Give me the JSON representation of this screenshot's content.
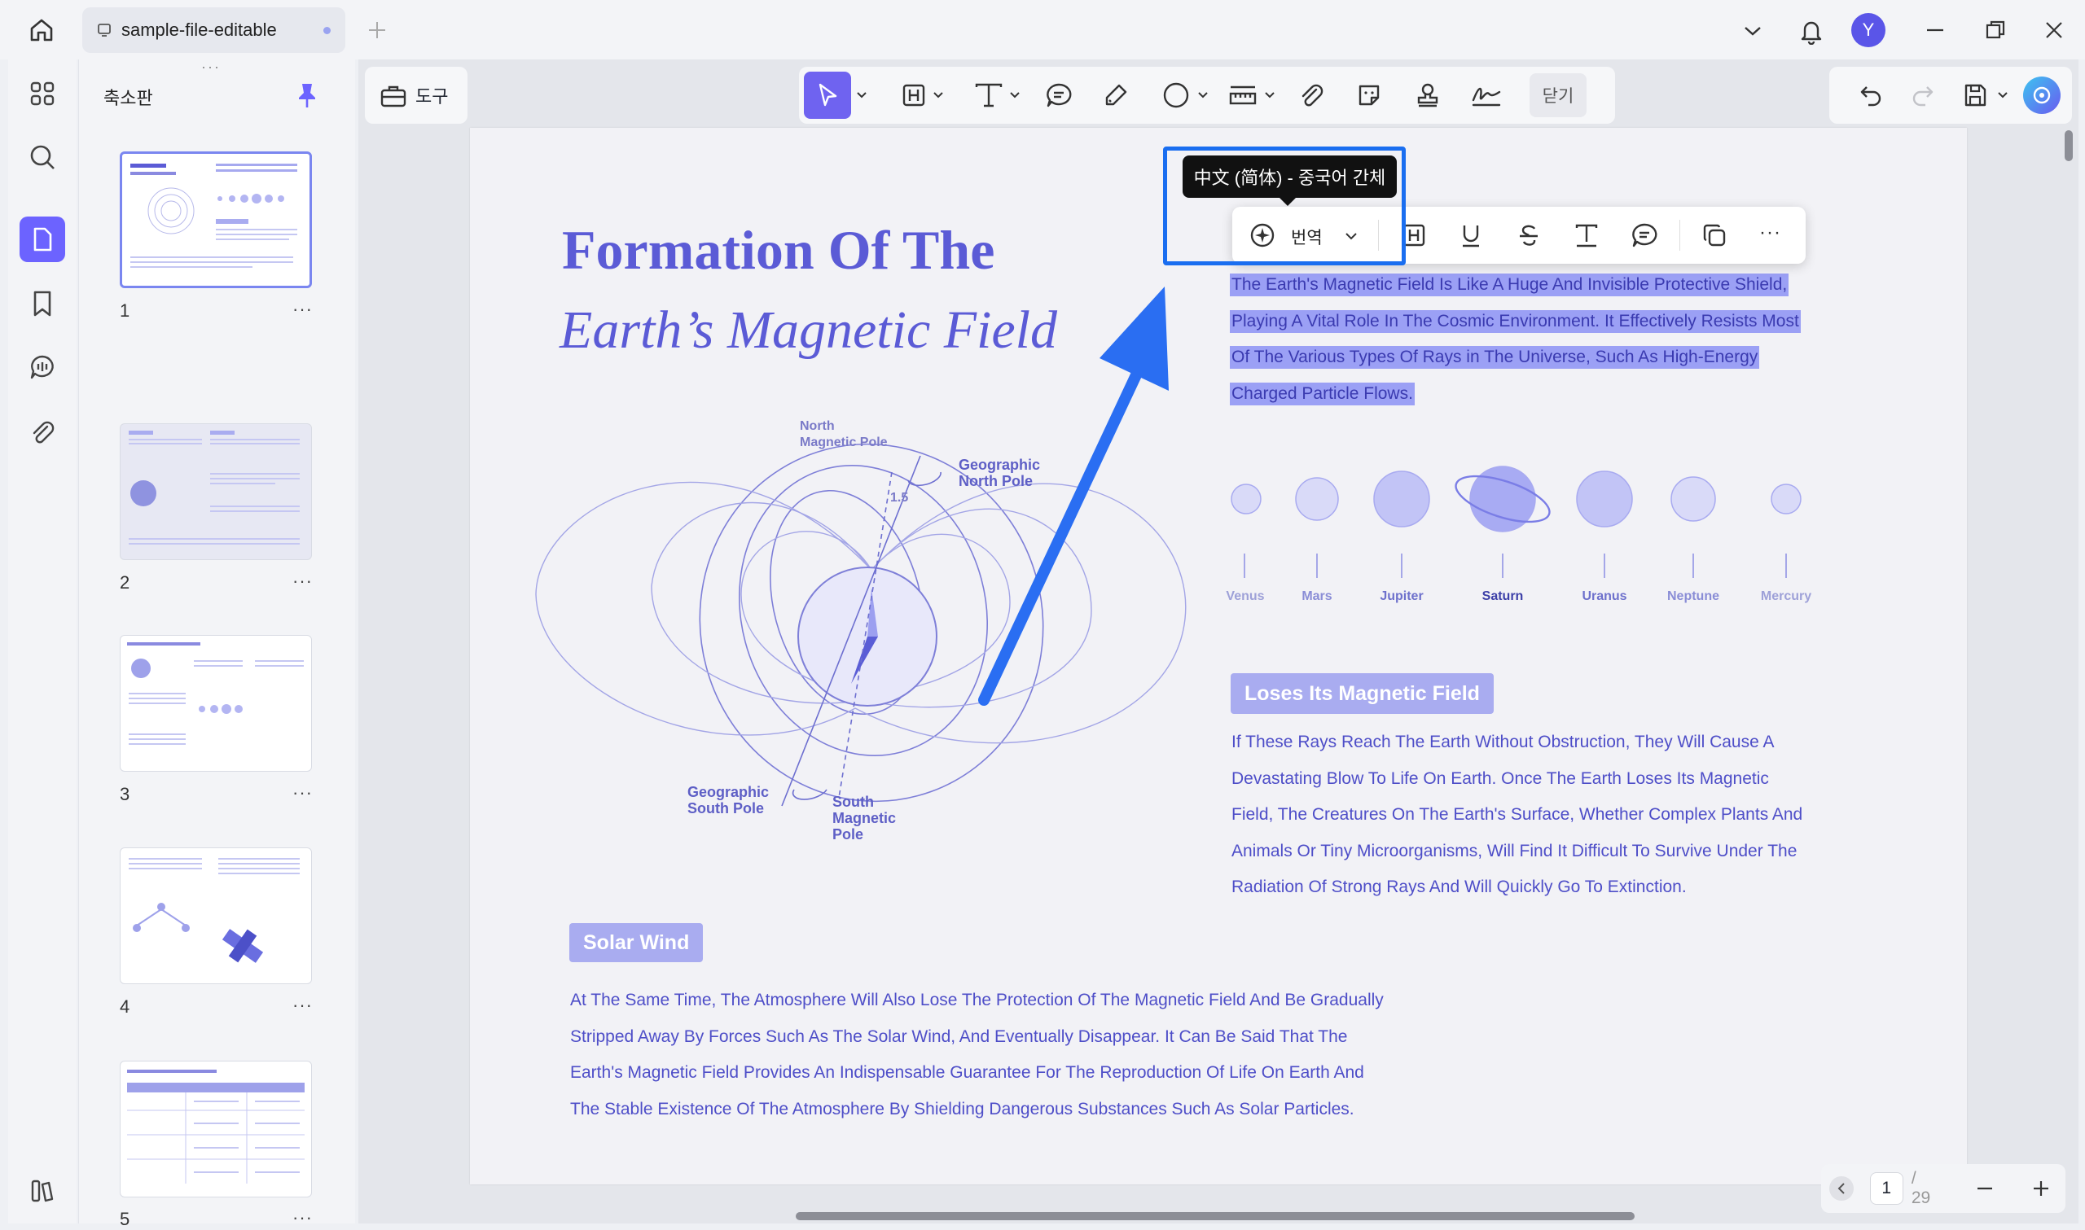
{
  "window": {
    "tab_title": "sample-file-editable",
    "user_initial": "Y"
  },
  "sidebar": {
    "panel_title": "축소판",
    "pages": [
      {
        "num": "1",
        "more": "···"
      },
      {
        "num": "2",
        "more": "···"
      },
      {
        "num": "3",
        "more": "···"
      },
      {
        "num": "4",
        "more": "···"
      },
      {
        "num": "5",
        "more": "···"
      }
    ]
  },
  "toolbar": {
    "tools_label": "도구",
    "close_label": "닫기"
  },
  "floating_toolbar": {
    "translate_label": "번역",
    "more": "···",
    "tooltip": "中文 (简体) - 중국어 간체"
  },
  "document": {
    "title_line1": "Formation Of The",
    "title_line2": "Earth’s Magnetic Field",
    "selected_paragraph": [
      "The Earth's Magnetic Field Is Like A Huge And Invisible Protective Shield,",
      "Playing A Vital Role In The Cosmic Environment. It Effectively Resists Most",
      "Of The Various Types Of Rays in The Universe, Such As High-Energy",
      "Charged Particle Flows."
    ],
    "diagram_labels": {
      "north_magnetic_pole": [
        "North",
        "Magnetic Pole"
      ],
      "geographic_north_pole": [
        "Geographic",
        "North Pole"
      ],
      "angle": "1.5",
      "geographic_south_pole": [
        "Geographic",
        "South Pole"
      ],
      "south_magnetic_pole": [
        "South",
        "Magnetic",
        "Pole"
      ]
    },
    "planets": [
      "Venus",
      "Mars",
      "Jupiter",
      "Saturn",
      "Uranus",
      "Neptune",
      "Mercury"
    ],
    "loses_heading": "Loses Its Magnetic Field",
    "loses_paragraph": [
      "If These Rays Reach The Earth Without Obstruction, They Will Cause A",
      "Devastating Blow To Life On Earth. Once The Earth Loses Its Magnetic",
      "Field, The Creatures On The Earth's Surface, Whether Complex Plants And",
      "Animals Or Tiny Microorganisms, Will Find It Difficult To Survive Under The",
      "Radiation Of Strong Rays And Will Quickly Go To Extinction."
    ],
    "solar_heading": "Solar Wind",
    "solar_paragraph": [
      "At The Same Time, The Atmosphere Will Also Lose The Protection Of The Magnetic Field And Be Gradually",
      "Stripped Away By Forces Such As The Solar Wind, And Eventually Disappear. It Can Be Said That The",
      "Earth's Magnetic Field Provides An Indispensable Guarantee For The Reproduction Of Life On Earth And",
      "The Stable Existence Of The Atmosphere By Shielding Dangerous Substances Such As Solar Particles."
    ]
  },
  "page_nav": {
    "current": "1",
    "total": "/ 29"
  },
  "colors": {
    "accent": "#5b5bd6",
    "highlight": "#9ba0f5",
    "focus": "#1a6ef0",
    "tool_active": "#6f63f0"
  }
}
